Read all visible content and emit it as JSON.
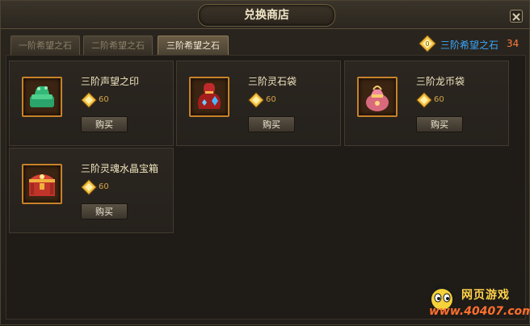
{
  "window": {
    "title": "兑换商店"
  },
  "tabs": [
    {
      "label": "一阶希望之石"
    },
    {
      "label": "二阶希望之石"
    },
    {
      "label": "三阶希望之石"
    }
  ],
  "currency": {
    "name": "三阶希望之石",
    "count": "34",
    "icon": "diamond-gem-icon",
    "color": "#3aa7ff"
  },
  "items": [
    {
      "name": "三阶声望之印",
      "price": "60",
      "buy_label": "购买",
      "icon": "green-seal-icon"
    },
    {
      "name": "三阶灵石袋",
      "price": "60",
      "buy_label": "购买",
      "icon": "red-bag-icon"
    },
    {
      "name": "三阶龙币袋",
      "price": "60",
      "buy_label": "购买",
      "icon": "pink-pouch-icon"
    },
    {
      "name": "三阶灵魂水晶宝箱",
      "price": "60",
      "buy_label": "购买",
      "icon": "treasure-chest-icon"
    }
  ],
  "watermark": {
    "title": "网页游戏",
    "url": "www.40407.com"
  }
}
